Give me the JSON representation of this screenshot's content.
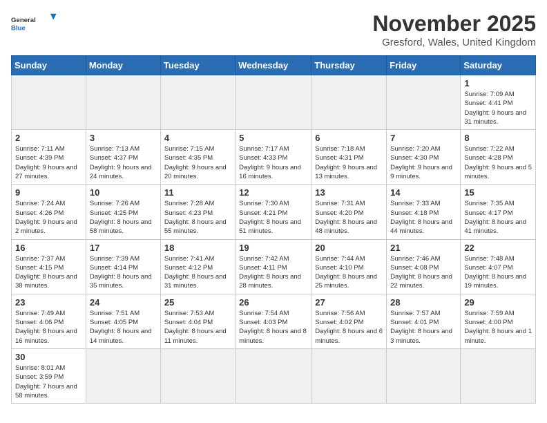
{
  "logo": {
    "text_general": "General",
    "text_blue": "Blue"
  },
  "header": {
    "month": "November 2025",
    "location": "Gresford, Wales, United Kingdom"
  },
  "days_of_week": [
    "Sunday",
    "Monday",
    "Tuesday",
    "Wednesday",
    "Thursday",
    "Friday",
    "Saturday"
  ],
  "weeks": [
    [
      {
        "day": "",
        "info": ""
      },
      {
        "day": "",
        "info": ""
      },
      {
        "day": "",
        "info": ""
      },
      {
        "day": "",
        "info": ""
      },
      {
        "day": "",
        "info": ""
      },
      {
        "day": "",
        "info": ""
      },
      {
        "day": "1",
        "info": "Sunrise: 7:09 AM\nSunset: 4:41 PM\nDaylight: 9 hours\nand 31 minutes."
      }
    ],
    [
      {
        "day": "2",
        "info": "Sunrise: 7:11 AM\nSunset: 4:39 PM\nDaylight: 9 hours\nand 27 minutes."
      },
      {
        "day": "3",
        "info": "Sunrise: 7:13 AM\nSunset: 4:37 PM\nDaylight: 9 hours\nand 24 minutes."
      },
      {
        "day": "4",
        "info": "Sunrise: 7:15 AM\nSunset: 4:35 PM\nDaylight: 9 hours\nand 20 minutes."
      },
      {
        "day": "5",
        "info": "Sunrise: 7:17 AM\nSunset: 4:33 PM\nDaylight: 9 hours\nand 16 minutes."
      },
      {
        "day": "6",
        "info": "Sunrise: 7:18 AM\nSunset: 4:31 PM\nDaylight: 9 hours\nand 13 minutes."
      },
      {
        "day": "7",
        "info": "Sunrise: 7:20 AM\nSunset: 4:30 PM\nDaylight: 9 hours\nand 9 minutes."
      },
      {
        "day": "8",
        "info": "Sunrise: 7:22 AM\nSunset: 4:28 PM\nDaylight: 9 hours\nand 5 minutes."
      }
    ],
    [
      {
        "day": "9",
        "info": "Sunrise: 7:24 AM\nSunset: 4:26 PM\nDaylight: 9 hours\nand 2 minutes."
      },
      {
        "day": "10",
        "info": "Sunrise: 7:26 AM\nSunset: 4:25 PM\nDaylight: 8 hours\nand 58 minutes."
      },
      {
        "day": "11",
        "info": "Sunrise: 7:28 AM\nSunset: 4:23 PM\nDaylight: 8 hours\nand 55 minutes."
      },
      {
        "day": "12",
        "info": "Sunrise: 7:30 AM\nSunset: 4:21 PM\nDaylight: 8 hours\nand 51 minutes."
      },
      {
        "day": "13",
        "info": "Sunrise: 7:31 AM\nSunset: 4:20 PM\nDaylight: 8 hours\nand 48 minutes."
      },
      {
        "day": "14",
        "info": "Sunrise: 7:33 AM\nSunset: 4:18 PM\nDaylight: 8 hours\nand 44 minutes."
      },
      {
        "day": "15",
        "info": "Sunrise: 7:35 AM\nSunset: 4:17 PM\nDaylight: 8 hours\nand 41 minutes."
      }
    ],
    [
      {
        "day": "16",
        "info": "Sunrise: 7:37 AM\nSunset: 4:15 PM\nDaylight: 8 hours\nand 38 minutes."
      },
      {
        "day": "17",
        "info": "Sunrise: 7:39 AM\nSunset: 4:14 PM\nDaylight: 8 hours\nand 35 minutes."
      },
      {
        "day": "18",
        "info": "Sunrise: 7:41 AM\nSunset: 4:12 PM\nDaylight: 8 hours\nand 31 minutes."
      },
      {
        "day": "19",
        "info": "Sunrise: 7:42 AM\nSunset: 4:11 PM\nDaylight: 8 hours\nand 28 minutes."
      },
      {
        "day": "20",
        "info": "Sunrise: 7:44 AM\nSunset: 4:10 PM\nDaylight: 8 hours\nand 25 minutes."
      },
      {
        "day": "21",
        "info": "Sunrise: 7:46 AM\nSunset: 4:08 PM\nDaylight: 8 hours\nand 22 minutes."
      },
      {
        "day": "22",
        "info": "Sunrise: 7:48 AM\nSunset: 4:07 PM\nDaylight: 8 hours\nand 19 minutes."
      }
    ],
    [
      {
        "day": "23",
        "info": "Sunrise: 7:49 AM\nSunset: 4:06 PM\nDaylight: 8 hours\nand 16 minutes."
      },
      {
        "day": "24",
        "info": "Sunrise: 7:51 AM\nSunset: 4:05 PM\nDaylight: 8 hours\nand 14 minutes."
      },
      {
        "day": "25",
        "info": "Sunrise: 7:53 AM\nSunset: 4:04 PM\nDaylight: 8 hours\nand 11 minutes."
      },
      {
        "day": "26",
        "info": "Sunrise: 7:54 AM\nSunset: 4:03 PM\nDaylight: 8 hours\nand 8 minutes."
      },
      {
        "day": "27",
        "info": "Sunrise: 7:56 AM\nSunset: 4:02 PM\nDaylight: 8 hours\nand 6 minutes."
      },
      {
        "day": "28",
        "info": "Sunrise: 7:57 AM\nSunset: 4:01 PM\nDaylight: 8 hours\nand 3 minutes."
      },
      {
        "day": "29",
        "info": "Sunrise: 7:59 AM\nSunset: 4:00 PM\nDaylight: 8 hours\nand 1 minute."
      }
    ],
    [
      {
        "day": "30",
        "info": "Sunrise: 8:01 AM\nSunset: 3:59 PM\nDaylight: 7 hours\nand 58 minutes."
      },
      {
        "day": "",
        "info": ""
      },
      {
        "day": "",
        "info": ""
      },
      {
        "day": "",
        "info": ""
      },
      {
        "day": "",
        "info": ""
      },
      {
        "day": "",
        "info": ""
      },
      {
        "day": "",
        "info": ""
      }
    ]
  ]
}
